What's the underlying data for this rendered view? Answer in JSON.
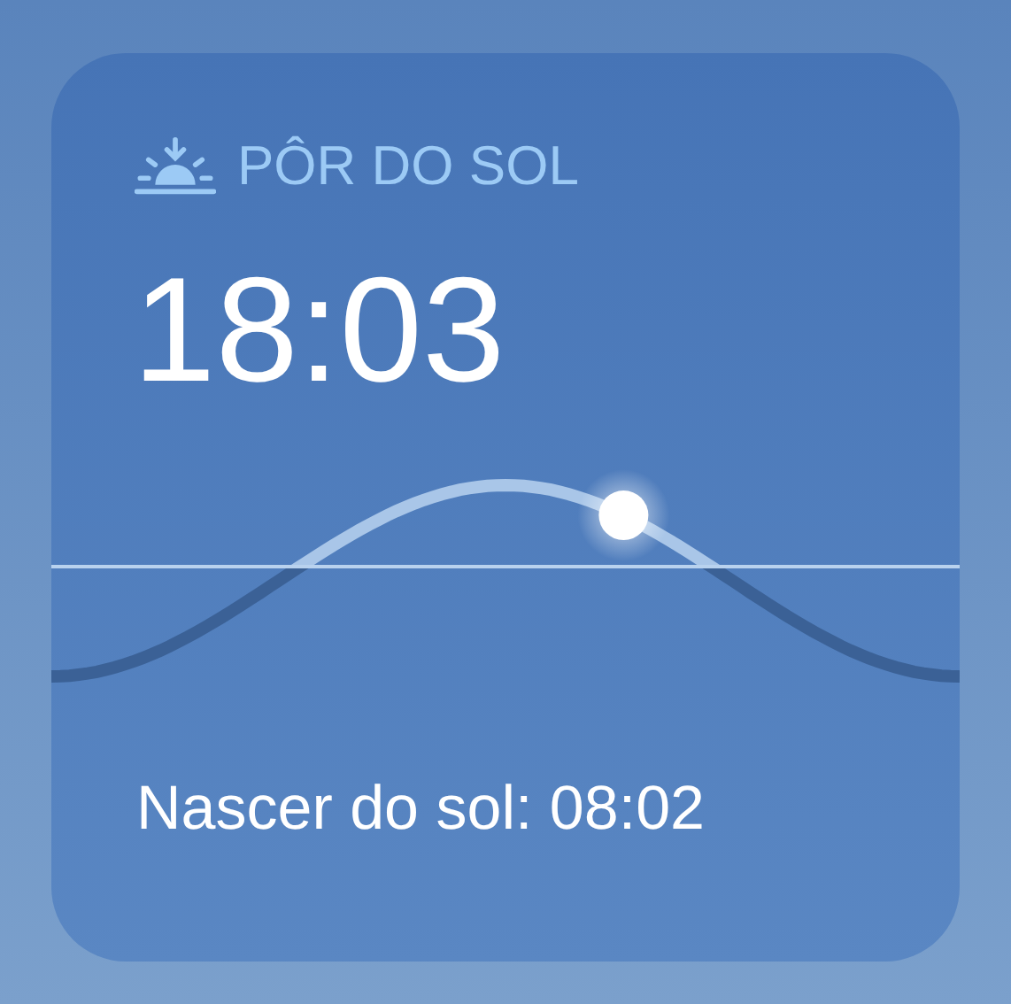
{
  "widget": {
    "title": "PÔR DO SOL",
    "time": "18:03",
    "subtitle": "Nascer do sol: 08:02"
  },
  "sun": {
    "level": 0.63
  }
}
